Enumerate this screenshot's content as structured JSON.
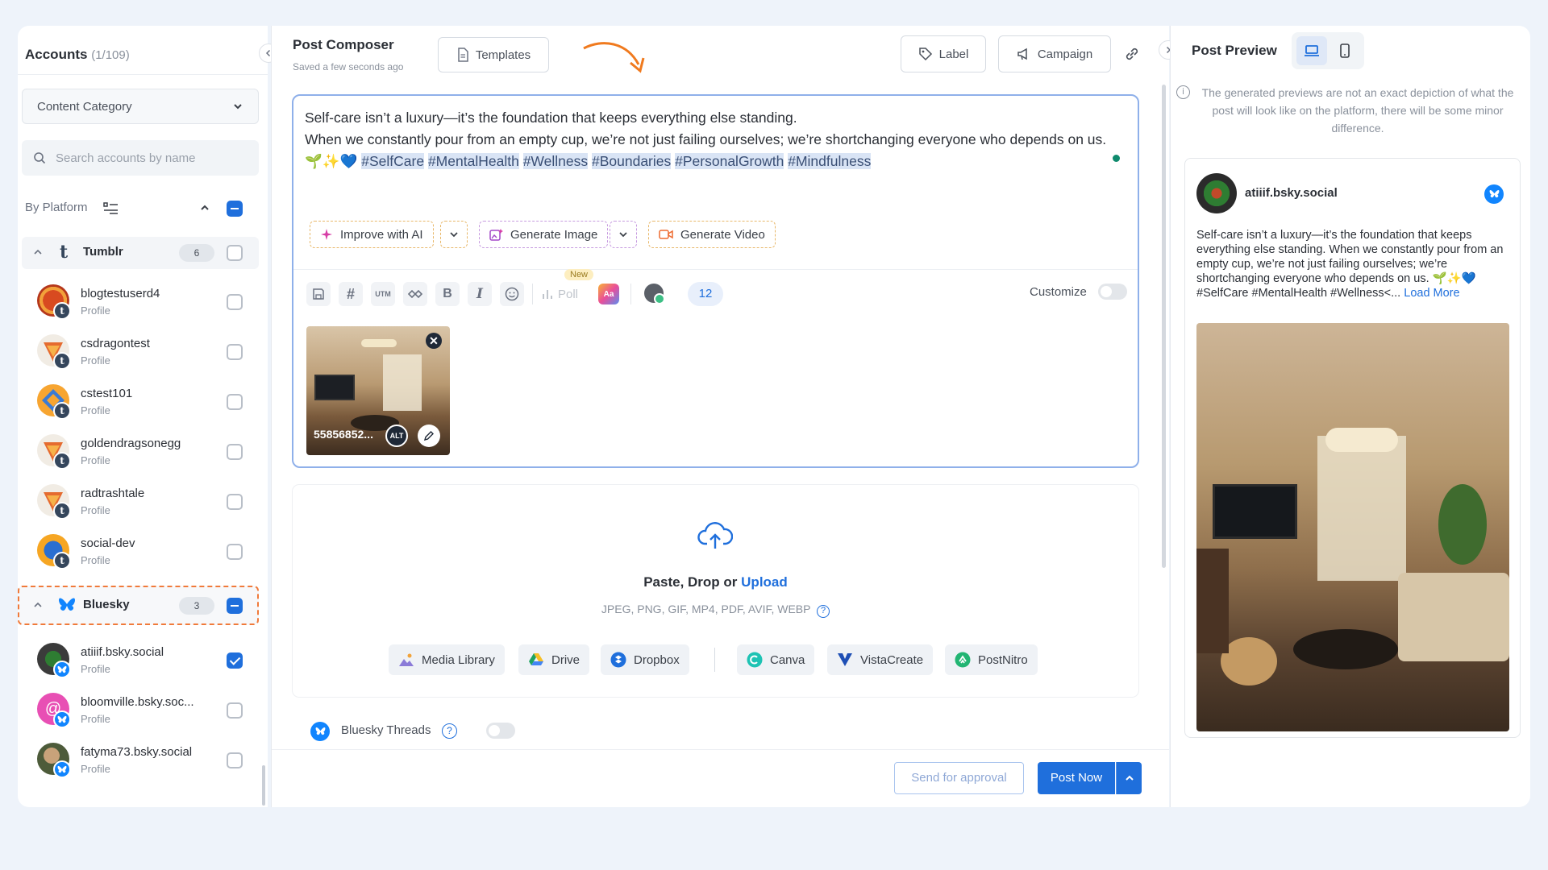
{
  "accounts_panel": {
    "title": "Accounts",
    "count": "(1/109)",
    "category_select": "Content Category",
    "search_placeholder": "Search accounts by name",
    "by_platform_label": "By Platform"
  },
  "tumblr_group": {
    "name": "Tumblr",
    "count": "6",
    "accounts": [
      {
        "name": "blogtestuserd4",
        "type": "Profile"
      },
      {
        "name": "csdragontest",
        "type": "Profile"
      },
      {
        "name": "cstest101",
        "type": "Profile"
      },
      {
        "name": "goldendragsonegg",
        "type": "Profile"
      },
      {
        "name": "radtrashtale",
        "type": "Profile"
      },
      {
        "name": "social-dev",
        "type": "Profile"
      }
    ]
  },
  "bluesky_group": {
    "name": "Bluesky",
    "count": "3",
    "accounts": [
      {
        "name": "atiiif.bsky.social",
        "type": "Profile",
        "checked": true
      },
      {
        "name": "bloomville.bsky.soc...",
        "type": "Profile",
        "checked": false
      },
      {
        "name": "fatyma73.bsky.social",
        "type": "Profile",
        "checked": false
      }
    ]
  },
  "composer": {
    "title": "Post Composer",
    "saved_status": "Saved a few seconds ago",
    "templates_label": "Templates",
    "label_button": "Label",
    "campaign_button": "Campaign",
    "text_line1": "Self-care isn’t a luxury—it’s the foundation that keeps everything else standing.",
    "text_line2": "When we constantly pour from an empty cup, we’re not just failing ourselves; we’re shortchanging everyone who depends on us.",
    "emojis": "🌱✨💙",
    "hashtags": [
      "#SelfCare",
      "#MentalHealth",
      "#Wellness",
      "#Boundaries",
      "#PersonalGrowth",
      "#Mindfulness"
    ],
    "improve_ai": "Improve with AI",
    "generate_image": "Generate Image",
    "generate_video": "Generate Video",
    "poll_label": "Poll",
    "new_badge": "New",
    "utm_label": "UTM",
    "count_badge": "12",
    "customize_label": "Customize",
    "media_name": "55856852...",
    "alt_label": "ALT"
  },
  "upload": {
    "title_prefix": "Paste, Drop or",
    "title_link": "Upload",
    "formats": "JPEG, PNG, GIF, MP4, PDF, AVIF, WEBP",
    "sources": [
      "Media Library",
      "Drive",
      "Dropbox",
      "Canva",
      "VistaCreate",
      "PostNitro"
    ]
  },
  "threads": {
    "label": "Bluesky Threads"
  },
  "footer": {
    "send_approval": "Send for approval",
    "post_now": "Post Now"
  },
  "preview": {
    "title": "Post Preview",
    "disclaimer": "The generated previews are not an exact depiction of what the post will look like on the platform, there will be some minor difference.",
    "account": "atiiif.bsky.social",
    "text": "Self-care isn’t a luxury—it’s the foundation that keeps everything else standing. When we constantly pour from an empty cup, we’re not just failing ourselves; we’re shortchanging everyone who depends on us. 🌱✨💙 #SelfCare #MentalHealth #Wellness<...",
    "load_more": "Load More"
  },
  "colors": {
    "accent": "#1f6fdc",
    "bluesky": "#1185fe",
    "tumblr": "#35465c",
    "highlight_dash": "#f07a3a"
  }
}
